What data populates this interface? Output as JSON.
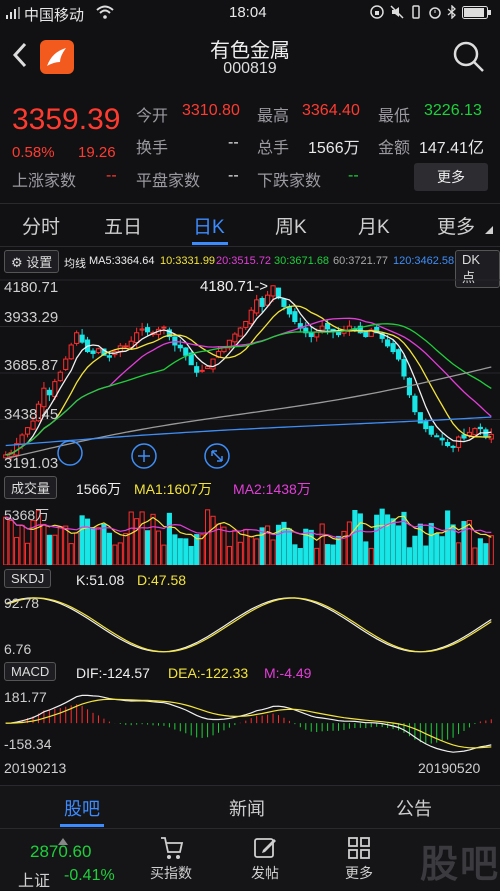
{
  "status": {
    "carrier": "中国移动",
    "time": "18:04"
  },
  "header": {
    "title": "有色金属",
    "code": "000819"
  },
  "quote": {
    "price": "3359.39",
    "change_pct": "0.58%",
    "change": "19.26",
    "open_label": "今开",
    "open": "3310.80",
    "high_label": "最高",
    "high": "3364.40",
    "low_label": "最低",
    "low": "3226.13",
    "turnover_label": "换手",
    "turnover": "--",
    "volume_label": "总手",
    "volume": "1566万",
    "amount_label": "金额",
    "amount": "147.41亿",
    "up_label": "上涨家数",
    "up": "--",
    "flat_label": "平盘家数",
    "flat": "--",
    "down_label": "下跌家数",
    "down": "--",
    "more_button": "更多"
  },
  "tabs": [
    {
      "label": "分时"
    },
    {
      "label": "五日"
    },
    {
      "label": "日K"
    },
    {
      "label": "周K"
    },
    {
      "label": "月K"
    },
    {
      "label": "更多"
    }
  ],
  "ma_bar": {
    "settings": "设置",
    "label": "均线",
    "ma5": "MA5:3364.64",
    "ma10": "10:3331.99",
    "ma20": "20:3515.72",
    "ma30": "30:3671.68",
    "ma60": "60:3721.77",
    "ma120": "120:3462.58",
    "dk_button": "DK点"
  },
  "kchart": {
    "y_top": "4180.71",
    "y_2": "3933.29",
    "y_3": "3685.87",
    "y_4": "3438.45",
    "y_bottom": "3191.03",
    "peak_annotation": "4180.71->"
  },
  "volume_panel": {
    "tab": "成交量",
    "vol": "1566万",
    "ma1": "MA1:1607万",
    "ma2": "MA2:1438万",
    "y_top": "5368万"
  },
  "skdj_panel": {
    "tab": "SKDJ",
    "k": "K:51.08",
    "d": "D:47.58",
    "y_top": "92.78",
    "y_bottom": "6.76"
  },
  "macd_panel": {
    "tab": "MACD",
    "dif": "DIF:-124.57",
    "dea": "DEA:-122.33",
    "m": "M:-4.49",
    "y_top": "181.77",
    "y_bottom": "-158.34"
  },
  "dates": {
    "start": "20190213",
    "end": "20190520"
  },
  "bottom_tabs": [
    {
      "label": "股吧"
    },
    {
      "label": "新闻"
    },
    {
      "label": "公告"
    }
  ],
  "bottom_bar": {
    "index_value": "2870.60",
    "index_name": "上证",
    "index_change": "-0.41%",
    "items": [
      {
        "label": "买指数"
      },
      {
        "label": "发帖"
      },
      {
        "label": "更多"
      }
    ]
  },
  "watermark": "股吧",
  "chart_data": {
    "type": "candlestick",
    "title": "",
    "ylim": [
      3191.03,
      4180.71
    ],
    "close": [
      3250,
      3262,
      3310,
      3356,
      3395,
      3430,
      3520,
      3605,
      3570,
      3640,
      3690,
      3760,
      3835,
      3900,
      3850,
      3800,
      3790,
      3815,
      3780,
      3770,
      3800,
      3830,
      3830,
      3855,
      3900,
      3920,
      3905,
      3900,
      3918,
      3930,
      3880,
      3835,
      3820,
      3780,
      3730,
      3690,
      3700,
      3720,
      3760,
      3800,
      3820,
      3860,
      3893,
      3925,
      3960,
      4020,
      4075,
      4040,
      4100,
      4150,
      4085,
      4040,
      4000,
      3960,
      3925,
      3900,
      3880,
      3905,
      3935,
      3920,
      3905,
      3890,
      3910,
      3935,
      3920,
      3900,
      3880,
      3915,
      3900,
      3870,
      3830,
      3800,
      3760,
      3670,
      3570,
      3480,
      3420,
      3390,
      3360,
      3350,
      3330,
      3300,
      3290,
      3345,
      3340,
      3370,
      3390,
      3390,
      3345,
      3359
    ],
    "ma5_last": 3364.64,
    "ma10_last": 3331.99,
    "ma20_last": 3515.72,
    "ma30_last": 3671.68,
    "ma60_last": 3721.77,
    "ma120_last": 3462.58,
    "volume_ylim_top": 5368,
    "skdj_ylim": [
      6.76,
      92.78
    ],
    "macd_ylim": [
      -158.34,
      181.77
    ],
    "x_start": "20190213",
    "x_end": "20190520"
  }
}
